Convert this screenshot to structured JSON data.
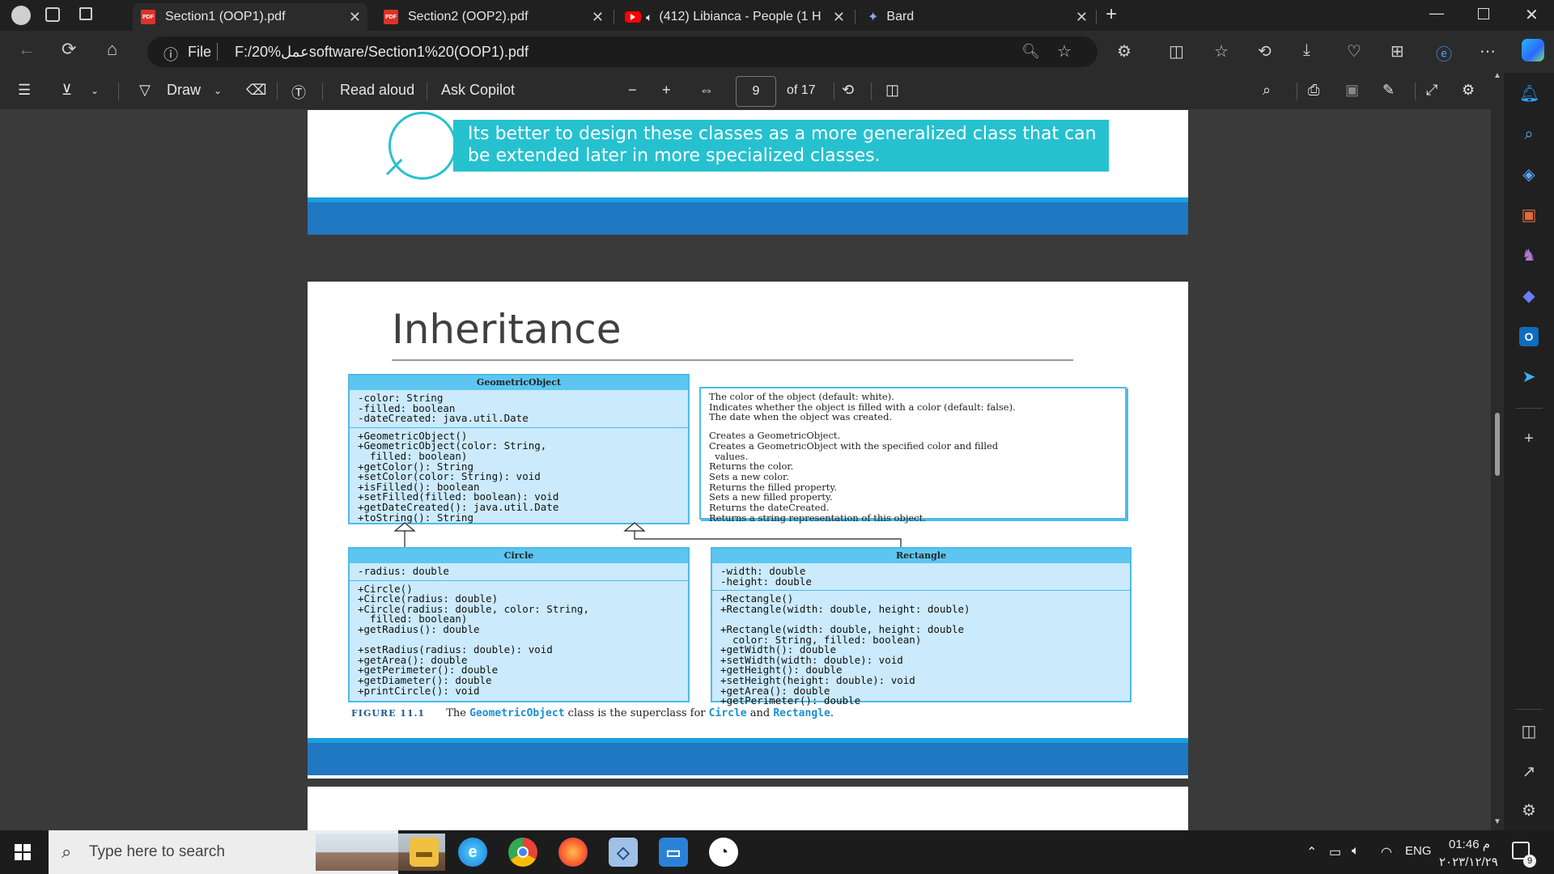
{
  "browser": {
    "tabs": [
      {
        "label": "Section1 (OOP1).pdf",
        "icon": "pdf-icon",
        "active": true
      },
      {
        "label": "Section2 (OOP2).pdf",
        "icon": "pdf-icon",
        "active": false
      },
      {
        "label": "(412) Libianca - People (1 H",
        "icon": "youtube-icon",
        "active": false
      },
      {
        "label": "Bard",
        "icon": "bard-icon",
        "active": false
      }
    ],
    "address": {
      "file_label": "File",
      "url": "F:/20%عملsoftware/Section1%20(OOP1).pdf"
    }
  },
  "pdf_toolbar": {
    "draw_label": "Draw",
    "read_aloud_label": "Read aloud",
    "ask_copilot_label": "Ask Copilot",
    "page_current": "9",
    "page_total": "of 17"
  },
  "document": {
    "callout_text": "Its better to design these classes as a more generalized class that can be extended later in more specialized classes.",
    "slide_title": "Inheritance",
    "uml": {
      "geometric": {
        "name": "GeometricObject",
        "fields": "-color: String\n-filled: boolean\n-dateCreated: java.util.Date",
        "methods": "+GeometricObject()\n+GeometricObject(color: String,\n  filled: boolean)\n+getColor(): String\n+setColor(color: String): void\n+isFilled(): boolean\n+setFilled(filled: boolean): void\n+getDateCreated(): java.util.Date\n+toString(): String"
      },
      "notes_fields": "The color of the object (default: white).\nIndicates whether the object is filled with a color (default: false).\nThe date when the object was created.",
      "notes_methods": "Creates a GeometricObject.\nCreates a GeometricObject with the specified color and filled\n  values.\nReturns the color.\nSets a new color.\nReturns the filled property.\nSets a new filled property.\nReturns the dateCreated.\nReturns a string representation of this object.",
      "circle": {
        "name": "Circle",
        "fields": "-radius: double",
        "methods": "+Circle()\n+Circle(radius: double)\n+Circle(radius: double, color: String,\n  filled: boolean)\n+getRadius(): double\n\n+setRadius(radius: double): void\n+getArea(): double\n+getPerimeter(): double\n+getDiameter(): double\n+printCircle(): void"
      },
      "rectangle": {
        "name": "Rectangle",
        "fields": "-width: double\n-height: double",
        "methods": "+Rectangle()\n+Rectangle(width: double, height: double)\n\n+Rectangle(width: double, height: double\n  color: String, filled: boolean)\n+getWidth(): double\n+setWidth(width: double): void\n+getHeight(): double\n+setHeight(height: double): void\n+getArea(): double\n+getPerimeter(): double"
      }
    },
    "figure_caption": {
      "label": "FIGURE 11.1",
      "text_1": "The",
      "code_1": "GeometricObject",
      "text_2": "class is the superclass for",
      "code_2": "Circle",
      "text_3": "and",
      "code_3": "Rectangle",
      "text_4": "."
    }
  },
  "taskbar": {
    "search_placeholder": "Type here to search",
    "language": "ENG",
    "time": "01:46 م",
    "date": "٢٠٢٣/١٢/٢٩",
    "notification_count": "9"
  },
  "colors": {
    "accent_teal": "#26c1cf",
    "uml_fill": "#cbeafb",
    "uml_header": "#5cc6f0",
    "page_band": "#1f78c1"
  }
}
